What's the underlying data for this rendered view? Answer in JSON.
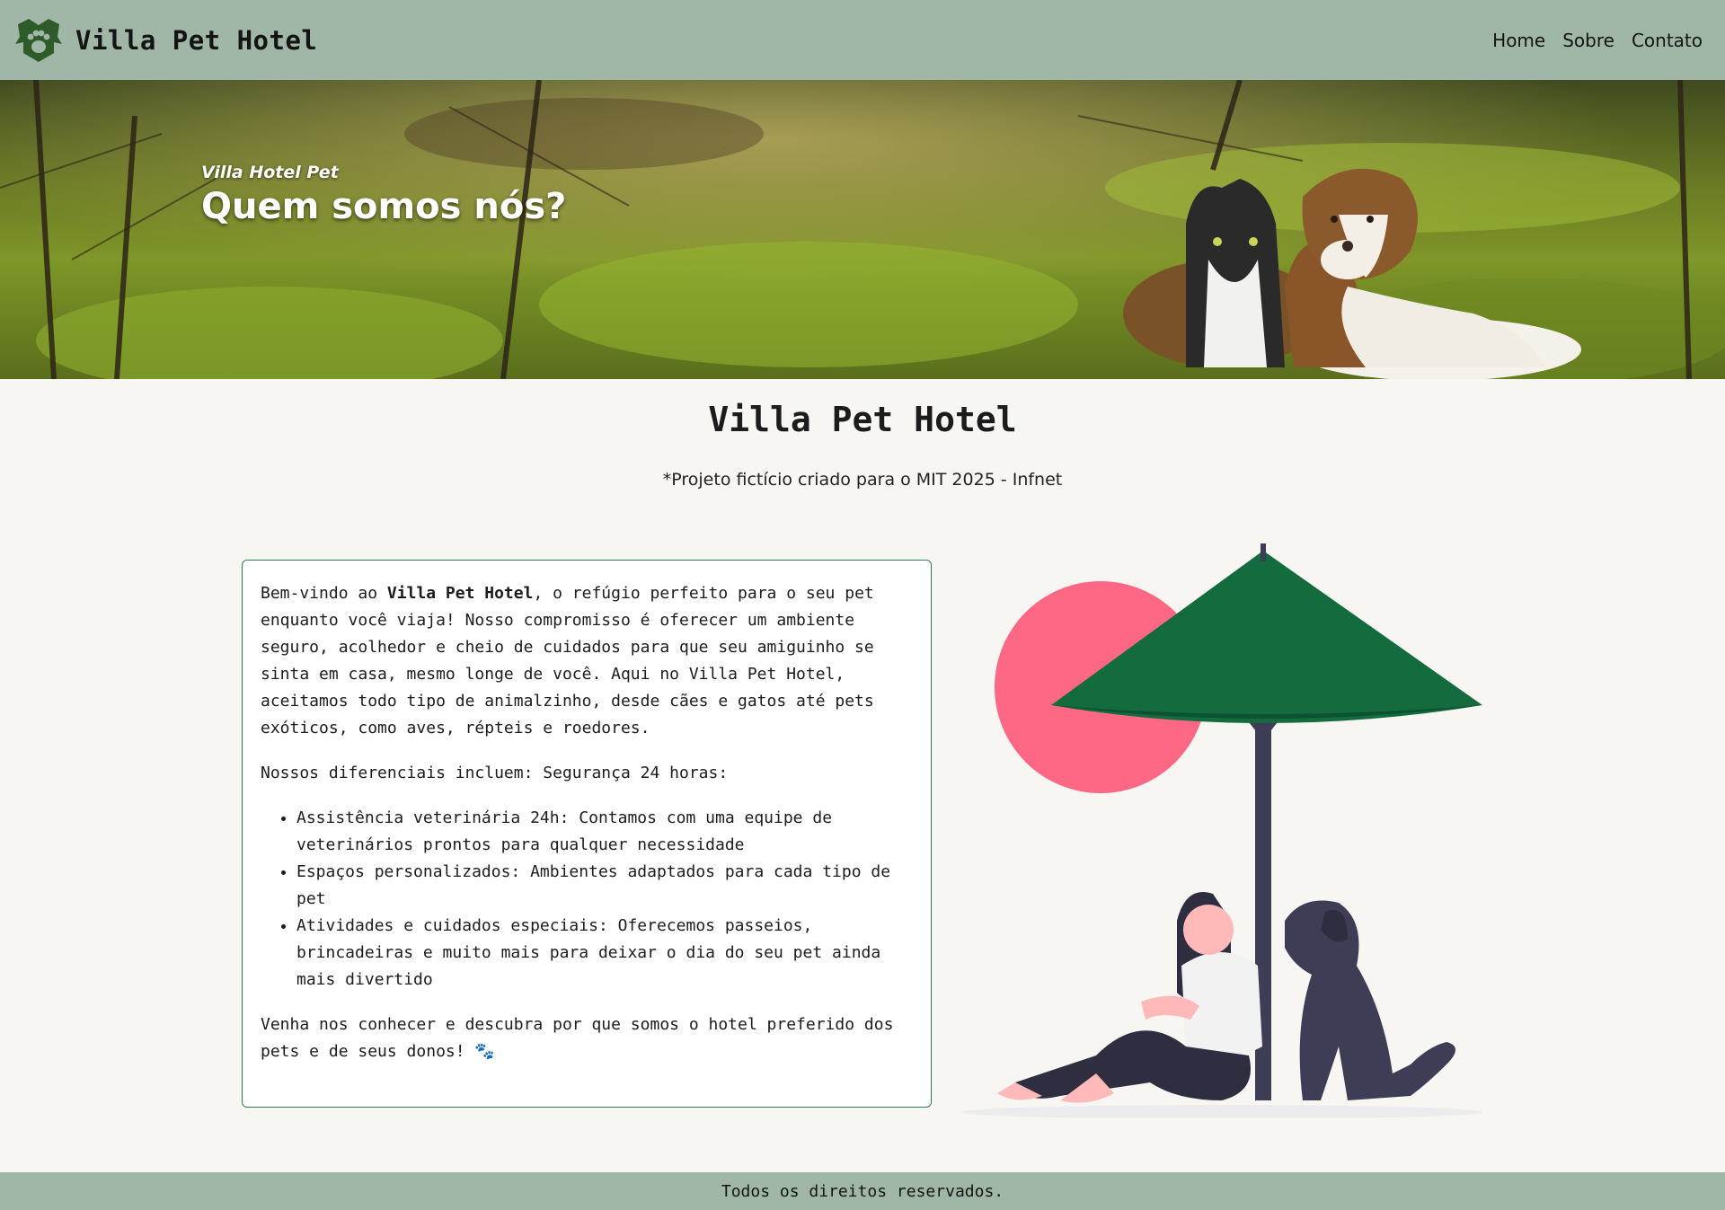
{
  "navbar": {
    "brand_name": "Villa Pet Hotel",
    "logo_icon": "dog-paw-logo-icon",
    "links": [
      "Home",
      "Sobre",
      "Contato"
    ]
  },
  "hero": {
    "subtitle": "Villa Hotel Pet",
    "title": "Quem somos nós?"
  },
  "main": {
    "title": "Villa Pet Hotel",
    "note": "*Projeto fictício criado para o MIT 2025 - Infnet",
    "intro_prefix": "Bem-vindo ao ",
    "intro_brand": "Villa Pet Hotel",
    "intro_rest": ", o refúgio perfeito para o seu pet enquanto você viaja! Nosso compromisso é oferecer um ambiente seguro, acolhedor e cheio de cuidados para que seu amiguinho se sinta em casa, mesmo longe de você. Aqui no Villa Pet Hotel, aceitamos todo tipo de animalzinho, desde cães e gatos até pets exóticos, como aves, répteis e roedores.",
    "features_intro": "Nossos diferenciais incluem: Segurança 24 horas:",
    "features": [
      "Assistência veterinária 24h: Contamos com uma equipe de veterinários prontos para qualquer necessidade",
      "Espaços personalizados: Ambientes adaptados para cada tipo de pet",
      "Atividades e cuidados especiais: Oferecemos passeios, brincadeiras e muito mais para deixar o dia do seu pet ainda mais divertido"
    ],
    "closing": "Venha nos conhecer e descubra por que somos o hotel preferido dos pets e de seus donos! 🐾"
  },
  "footer": {
    "text": "Todos os direitos reservados."
  },
  "colors": {
    "navbar_bg": "#a0b7a7",
    "page_bg": "#f7f6f2",
    "card_border": "#2e7d4f",
    "umbrella": "#136b3e",
    "sun": "#ff6884"
  }
}
